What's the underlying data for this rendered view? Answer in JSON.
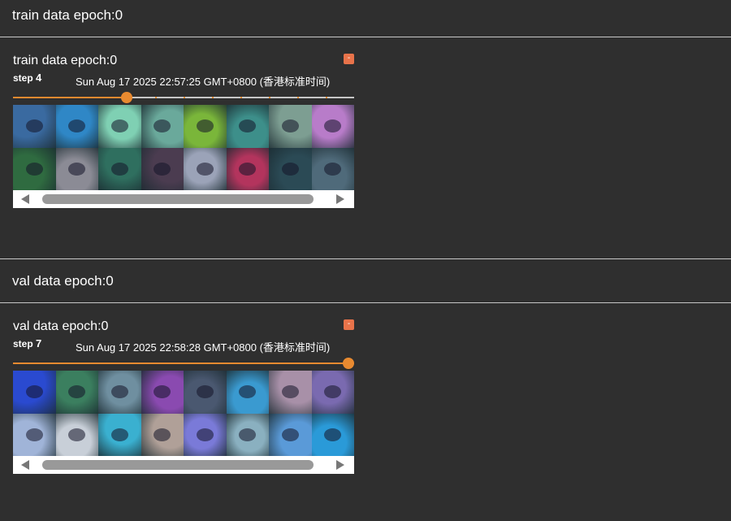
{
  "accent": "#e88a30",
  "sections": [
    {
      "header": "train data epoch:0",
      "card": {
        "title": "train data epoch:0",
        "expand_icon": "-",
        "step_label": "step",
        "step_value": "4",
        "timestamp": "Sun Aug 17 2025 22:57:25 GMT+0800 (香港标准时间)",
        "slider_fraction": 0.333,
        "slider_steps": 12,
        "thumb_colors": [
          [
            "#3a6aa0",
            "#2f87c6",
            "#7fd0b3",
            "#6aa99b",
            "#7ab63a",
            "#3d8f8a",
            "#7d9e92",
            "#b87cc9"
          ],
          [
            "#2f6b40",
            "#8b8b95",
            "#2f6f5f",
            "#4b3c50",
            "#9ba3b8",
            "#b3345d",
            "#2b4a55",
            "#4f6a7a"
          ]
        ]
      }
    },
    {
      "header": "val data epoch:0",
      "card": {
        "title": "val data epoch:0",
        "expand_icon": "-",
        "step_label": "step",
        "step_value": "7",
        "timestamp": "Sun Aug 17 2025 22:58:28 GMT+0800 (香港标准时间)",
        "slider_fraction": 1.0,
        "slider_steps": 8,
        "thumb_colors": [
          [
            "#2a4ad0",
            "#3b7f5f",
            "#6f8fa0",
            "#8a4ab0",
            "#4a5870",
            "#3a9ad0",
            "#a890a8",
            "#7a6ab0"
          ],
          [
            "#a0b4d8",
            "#c8cfd8",
            "#3ab0d0",
            "#b0a098",
            "#7a7ad8",
            "#8ab0c0",
            "#5a9ad8",
            "#2a9ad8"
          ]
        ]
      }
    }
  ]
}
